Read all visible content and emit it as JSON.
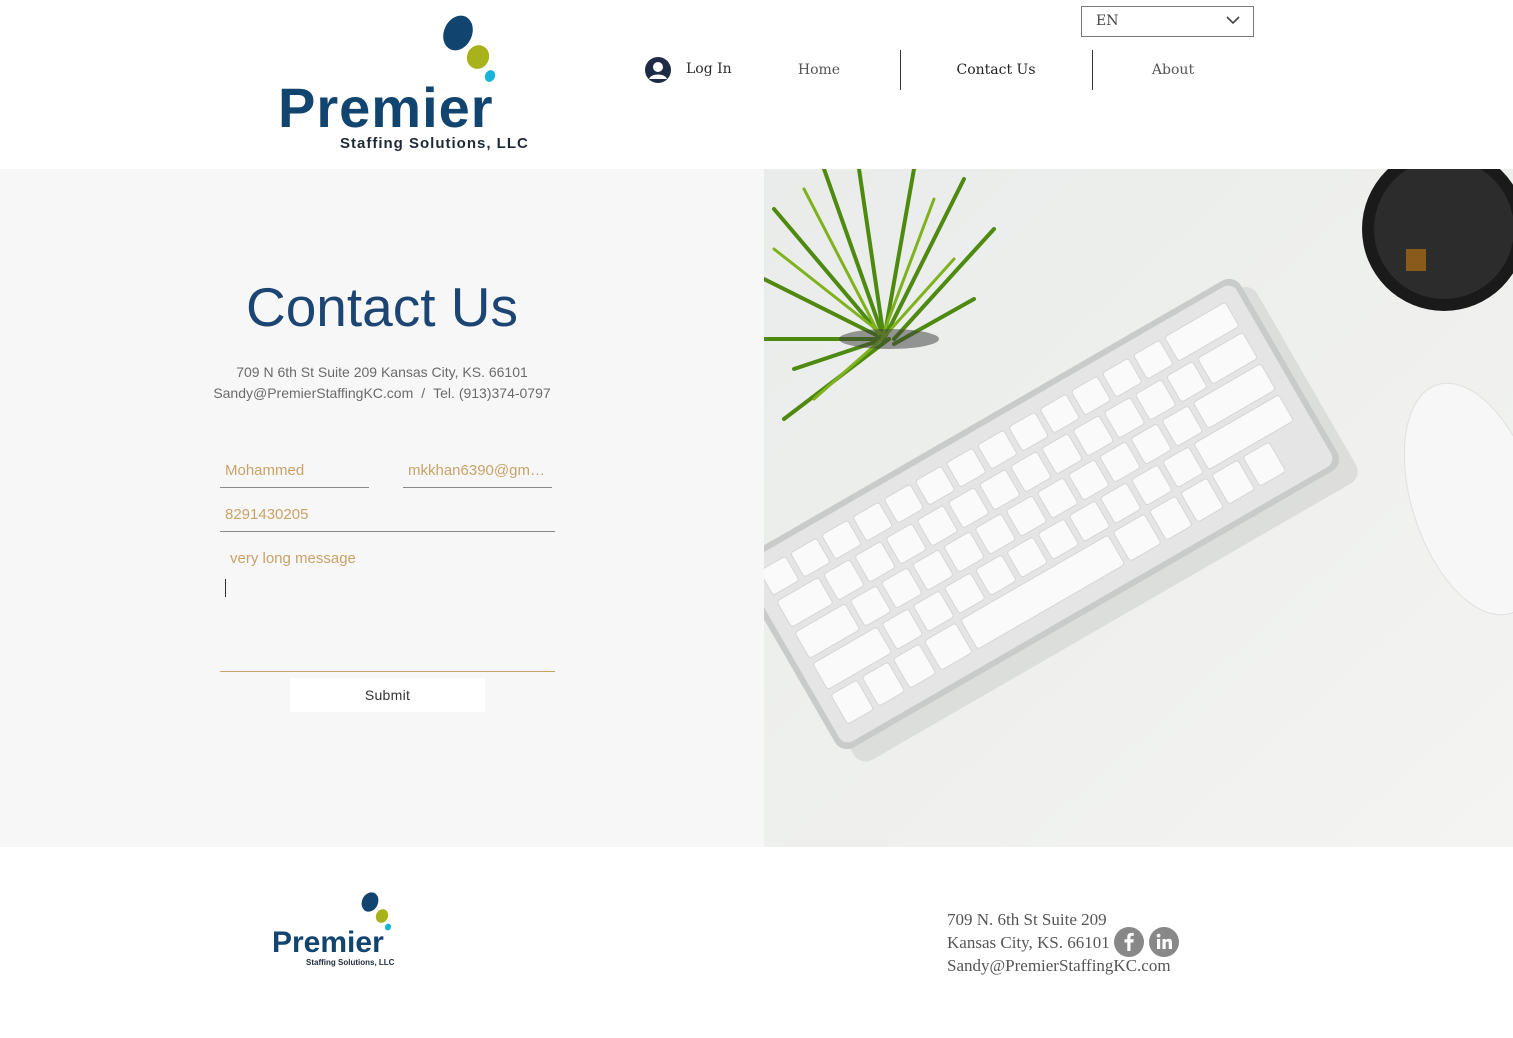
{
  "brand": {
    "name": "Premier",
    "tagline": "Staffing Solutions, LLC",
    "colors": {
      "navy": "#11446f",
      "lime": "#a8b31b",
      "cyan": "#1ab3d8"
    }
  },
  "header": {
    "language": {
      "selected": "EN"
    },
    "login_label": "Log In",
    "nav": [
      {
        "label": "Home"
      },
      {
        "label": "Contact Us",
        "active": true
      },
      {
        "label": "About"
      }
    ]
  },
  "contact": {
    "title": "Contact Us",
    "address": "709 N 6th St Suite 209 Kansas City, KS. 66101",
    "email": "Sandy@PremierStaffingKC.com",
    "separator": "/",
    "phone": "Tel. (913)374-0797",
    "form": {
      "name_value": "Mohammed",
      "email_value": "mkkhan6390@gma...",
      "phone_value": "8291430205",
      "message_value": "very long message",
      "submit_label": "Submit"
    }
  },
  "footer": {
    "address_line1": "709 N. 6th St Suite 209",
    "address_line2": "Kansas City, KS. 66101",
    "email": "Sandy@PremierStaffingKC.com",
    "social": [
      {
        "name": "facebook",
        "icon": "facebook-icon"
      },
      {
        "name": "linkedin",
        "icon": "linkedin-icon"
      }
    ]
  }
}
